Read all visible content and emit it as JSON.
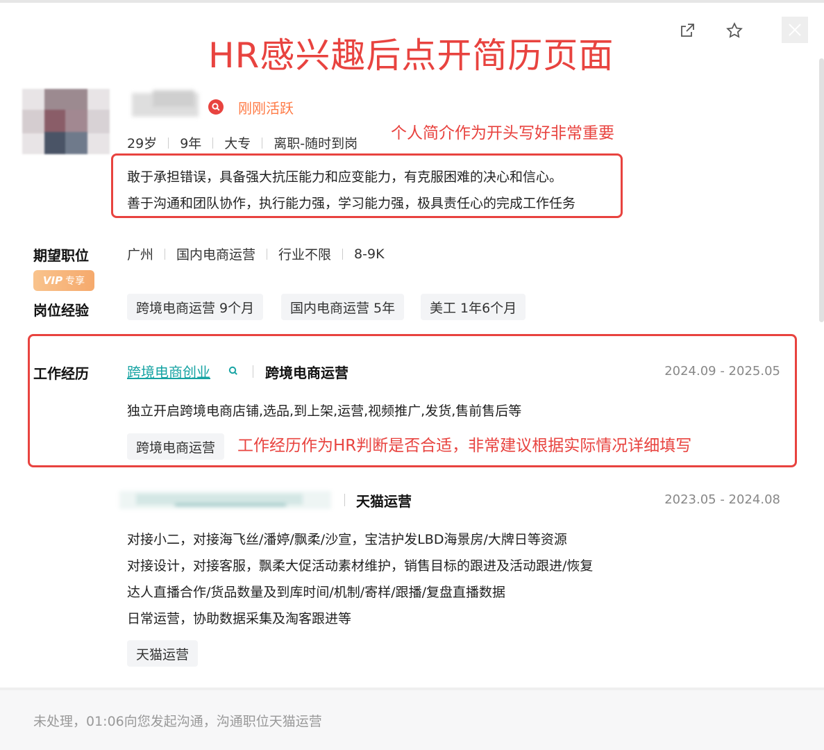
{
  "annotations": {
    "title": "HR感兴趣后点开简历页面",
    "intro_note": "个人简介作为开头写好非常重要",
    "work_note": "工作经历作为HR判断是否合适，非常建议根据实际情况详细填写"
  },
  "profile": {
    "active_status": "刚刚活跃",
    "meta": [
      "29岁",
      "9年",
      "大专",
      "离职-随时到岗"
    ],
    "intro_lines": [
      "敢于承担错误，具备强大抗压能力和应变能力，有克服困难的决心和信心。",
      "善于沟通和团队协作，执行能力强，学习能力强，极具责任心的完成工作任务"
    ]
  },
  "expectation": {
    "label": "期望职位",
    "items": [
      "广州",
      "国内电商运营",
      "行业不限",
      "8-9K"
    ]
  },
  "vip_badge": {
    "mark": "VIP",
    "text": "专享"
  },
  "experience": {
    "label": "岗位经验",
    "tags": [
      "跨境电商运营 9个月",
      "国内电商运营 5年",
      "美工 1年6个月"
    ]
  },
  "work_history": {
    "label": "工作经历",
    "entries": [
      {
        "company": "跨境电商创业",
        "role": "跨境电商运营",
        "dates": "2024.09 - 2025.05",
        "desc": [
          "独立开启跨境电商店铺,选品,到上架,运营,视频推广,发货,售前售后等"
        ],
        "tag": "跨境电商运营"
      },
      {
        "role": "天猫运营",
        "dates": "2023.05 - 2024.08",
        "desc": [
          "对接小二，对接海飞丝/潘婷/飘柔/沙宣，宝洁护发LBD海景房/大牌日等资源",
          "对接设计，对接客服，飘柔大促活动素材维护，销售目标的跟进及活动跟进/恢复",
          "达人直播合作/货品数量及到库时间/机制/寄样/跟播/复盘直播数据",
          "日常运营，协助数据采集及淘客跟进等"
        ],
        "tag": "天猫运营"
      }
    ]
  },
  "footer": {
    "status": "未处理，01:06向您发起沟通，沟通职位天猫运营"
  },
  "icons": {
    "share": "external-link-icon",
    "favorite": "star-icon",
    "close": "close-icon",
    "active": "search-badge-icon",
    "company_search": "search-icon"
  }
}
